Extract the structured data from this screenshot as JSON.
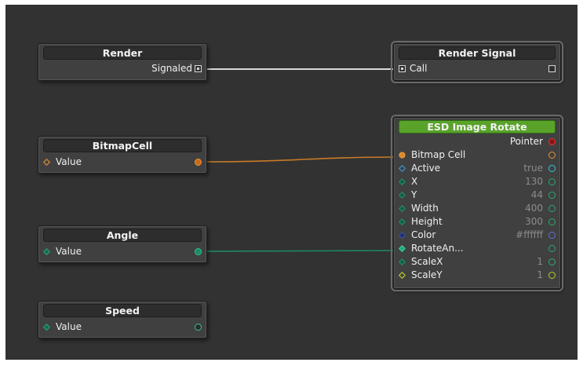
{
  "colors": {
    "canvas": "#323232",
    "node": "#404040",
    "title": "#2d2d2d",
    "title_green": "#5aa32a",
    "wire_signal": "#d8d8d8",
    "wire_bitmap": "#c87a26",
    "wire_angle": "#1f8a64"
  },
  "nodes": {
    "render": {
      "title": "Render",
      "out_label": "Signaled"
    },
    "render_signal": {
      "title": "Render Signal",
      "in_label": "Call"
    },
    "bitmapcell": {
      "title": "BitmapCell",
      "in_label": "Value"
    },
    "angle": {
      "title": "Angle",
      "in_label": "Value"
    },
    "speed": {
      "title": "Speed",
      "in_label": "Value"
    },
    "esd": {
      "title": "ESD Image Rotate",
      "output_label": "Pointer",
      "inputs": [
        {
          "label": "Bitmap Cell",
          "value": "",
          "icon": "orange-circle",
          "port": "orange-filled"
        },
        {
          "label": "Active",
          "value": "true",
          "icon": "blue-diamond",
          "port": "cyan-ring"
        },
        {
          "label": "X",
          "value": "130",
          "icon": "green-diamond",
          "port": "green-ring"
        },
        {
          "label": "Y",
          "value": "44",
          "icon": "green-diamond",
          "port": "green-ring"
        },
        {
          "label": "Width",
          "value": "400",
          "icon": "green-diamond",
          "port": "green-ring"
        },
        {
          "label": "Height",
          "value": "300",
          "icon": "green-diamond",
          "port": "green-ring"
        },
        {
          "label": "Color",
          "value": "#ffffff",
          "icon": "navy-diamond",
          "port": "navy-ring"
        },
        {
          "label": "RotateAn...",
          "value": "",
          "icon": "teal-diamond",
          "port": "green-ring"
        },
        {
          "label": "ScaleX",
          "value": "1",
          "icon": "green-diamond",
          "port": "green-ring"
        },
        {
          "label": "ScaleY",
          "value": "1",
          "icon": "yellow-diamond",
          "port": "yellow-ring"
        }
      ]
    }
  }
}
